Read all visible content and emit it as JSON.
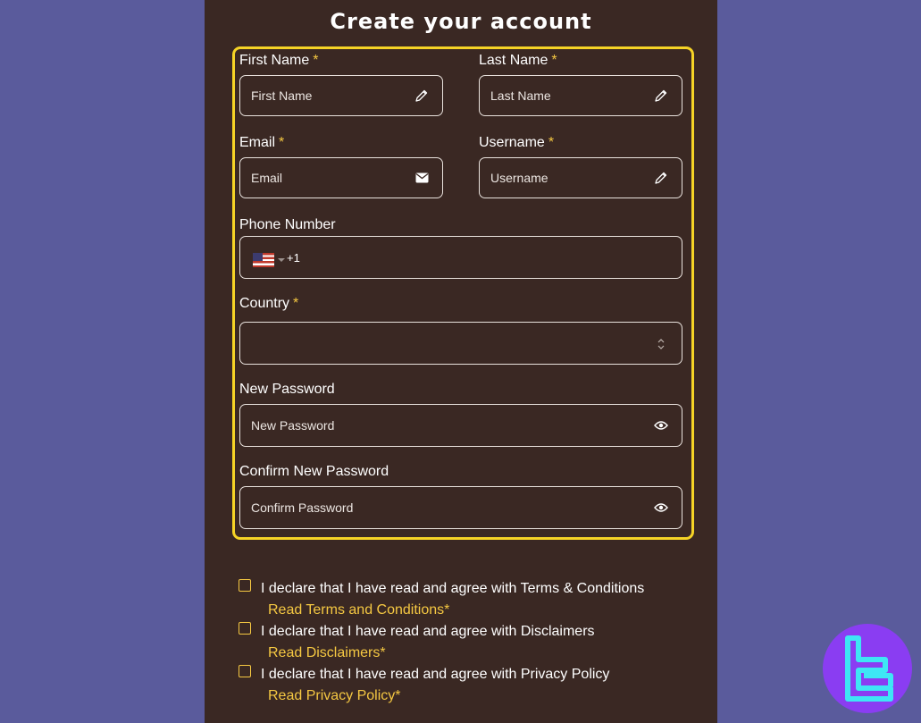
{
  "title": "Create your account",
  "required_mark": "*",
  "fields": {
    "first_name": {
      "label": "First Name",
      "placeholder": "First Name",
      "icon": "pencil-icon"
    },
    "last_name": {
      "label": "Last Name",
      "placeholder": "Last Name",
      "icon": "pencil-icon"
    },
    "email": {
      "label": "Email",
      "placeholder": "Email",
      "icon": "envelope-icon"
    },
    "username": {
      "label": "Username",
      "placeholder": "Username",
      "icon": "pencil-icon"
    },
    "phone": {
      "label": "Phone Number",
      "dial_code": "+1",
      "flag": "us-flag-icon"
    },
    "country": {
      "label": "Country",
      "value": "",
      "icon": "select-arrows-icon"
    },
    "new_password": {
      "label": "New Password",
      "placeholder": "New Password",
      "icon": "eye-icon"
    },
    "confirm_password": {
      "label": "Confirm New Password",
      "placeholder": "Confirm Password",
      "icon": "eye-icon"
    }
  },
  "agreements": [
    {
      "text": "I declare that I have read and agree with Terms & Conditions",
      "link": "Read Terms and Conditions*"
    },
    {
      "text": "I declare that I have read and agree with Disclaimers",
      "link": "Read Disclaimers*"
    },
    {
      "text": "I declare that I have read and agree with Privacy Policy",
      "link": "Read Privacy Policy*"
    }
  ],
  "colors": {
    "background": "#5a5b9c",
    "panel": "#3a2823",
    "highlight": "#f5d326",
    "accent": "#f5c842",
    "logo": "#8a3df2",
    "logo_mark": "#3ee6f5"
  }
}
